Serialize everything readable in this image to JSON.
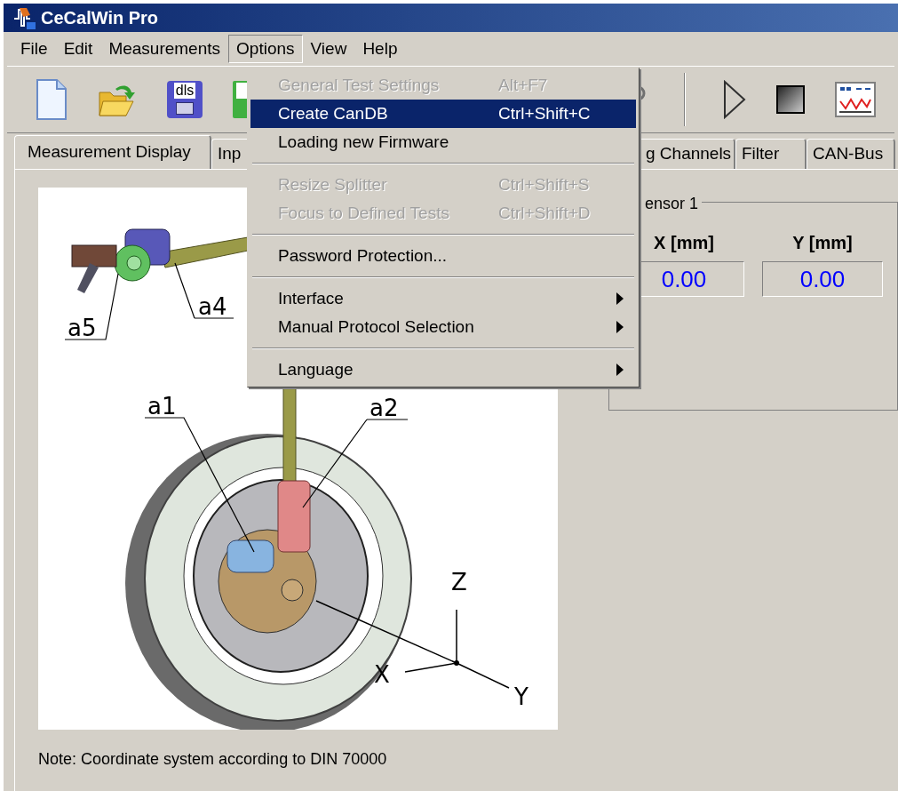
{
  "window": {
    "title": "CeCalWin Pro"
  },
  "menu_bar": [
    {
      "label": "File",
      "selected": false
    },
    {
      "label": "Edit",
      "selected": false
    },
    {
      "label": "Measurements",
      "selected": false
    },
    {
      "label": "Options",
      "selected": true
    },
    {
      "label": "View",
      "selected": false
    },
    {
      "label": "Help",
      "selected": false
    }
  ],
  "toolbar": [
    {
      "kind": "new"
    },
    {
      "kind": "open"
    },
    {
      "kind": "save",
      "label": "dls"
    },
    {
      "kind": "save_green"
    },
    {
      "kind": "device"
    },
    {
      "kind": "separator"
    },
    {
      "kind": "play"
    },
    {
      "kind": "stop"
    },
    {
      "kind": "chart"
    }
  ],
  "tabs": [
    {
      "label": "Measurement Display",
      "selected": true
    },
    {
      "label": "Inp",
      "selected": false
    },
    {
      "label": "g Channels",
      "selected": false
    },
    {
      "label": "Filter",
      "selected": false
    },
    {
      "label": "CAN-Bus",
      "selected": false
    }
  ],
  "drawing_labels": [
    {
      "text": "a5",
      "kind": "part"
    },
    {
      "text": "a4",
      "kind": "part"
    },
    {
      "text": "a1",
      "kind": "part"
    },
    {
      "text": "a2",
      "kind": "part"
    },
    {
      "text": "Z",
      "kind": "axis"
    },
    {
      "text": "X",
      "kind": "axis"
    },
    {
      "text": "Y",
      "kind": "axis"
    }
  ],
  "note": "Note: Coordinate system according to DIN 70000",
  "sensor_group": {
    "title": "ensor 1",
    "columns": [
      {
        "header": "X [mm]",
        "value": "0.00"
      },
      {
        "header": "Y [mm]",
        "value": "0.00"
      }
    ]
  },
  "options_menu": [
    {
      "kind": "item",
      "label": "General Test Settings",
      "shortcut": "Alt+F7",
      "disabled": true,
      "selected": false,
      "submenu": false
    },
    {
      "kind": "item",
      "label": "Create CanDB",
      "shortcut": "Ctrl+Shift+C",
      "disabled": false,
      "selected": true,
      "submenu": false
    },
    {
      "kind": "item",
      "label": "Loading new Firmware",
      "disabled": false,
      "selected": false,
      "submenu": false
    },
    {
      "kind": "separator"
    },
    {
      "kind": "item",
      "label": "Resize Splitter",
      "shortcut": "Ctrl+Shift+S",
      "disabled": true,
      "selected": false,
      "submenu": false
    },
    {
      "kind": "item",
      "label": "Focus to Defined Tests",
      "shortcut": "Ctrl+Shift+D",
      "disabled": true,
      "selected": false,
      "submenu": false
    },
    {
      "kind": "separator"
    },
    {
      "kind": "item",
      "label": "Password Protection...",
      "disabled": false,
      "selected": false,
      "submenu": false
    },
    {
      "kind": "separator"
    },
    {
      "kind": "item",
      "label": "Interface",
      "disabled": false,
      "selected": false,
      "submenu": true
    },
    {
      "kind": "item",
      "label": "Manual Protocol Selection",
      "disabled": false,
      "selected": false,
      "submenu": true
    },
    {
      "kind": "separator"
    },
    {
      "kind": "item",
      "label": "Language",
      "disabled": false,
      "selected": false,
      "submenu": true
    }
  ]
}
